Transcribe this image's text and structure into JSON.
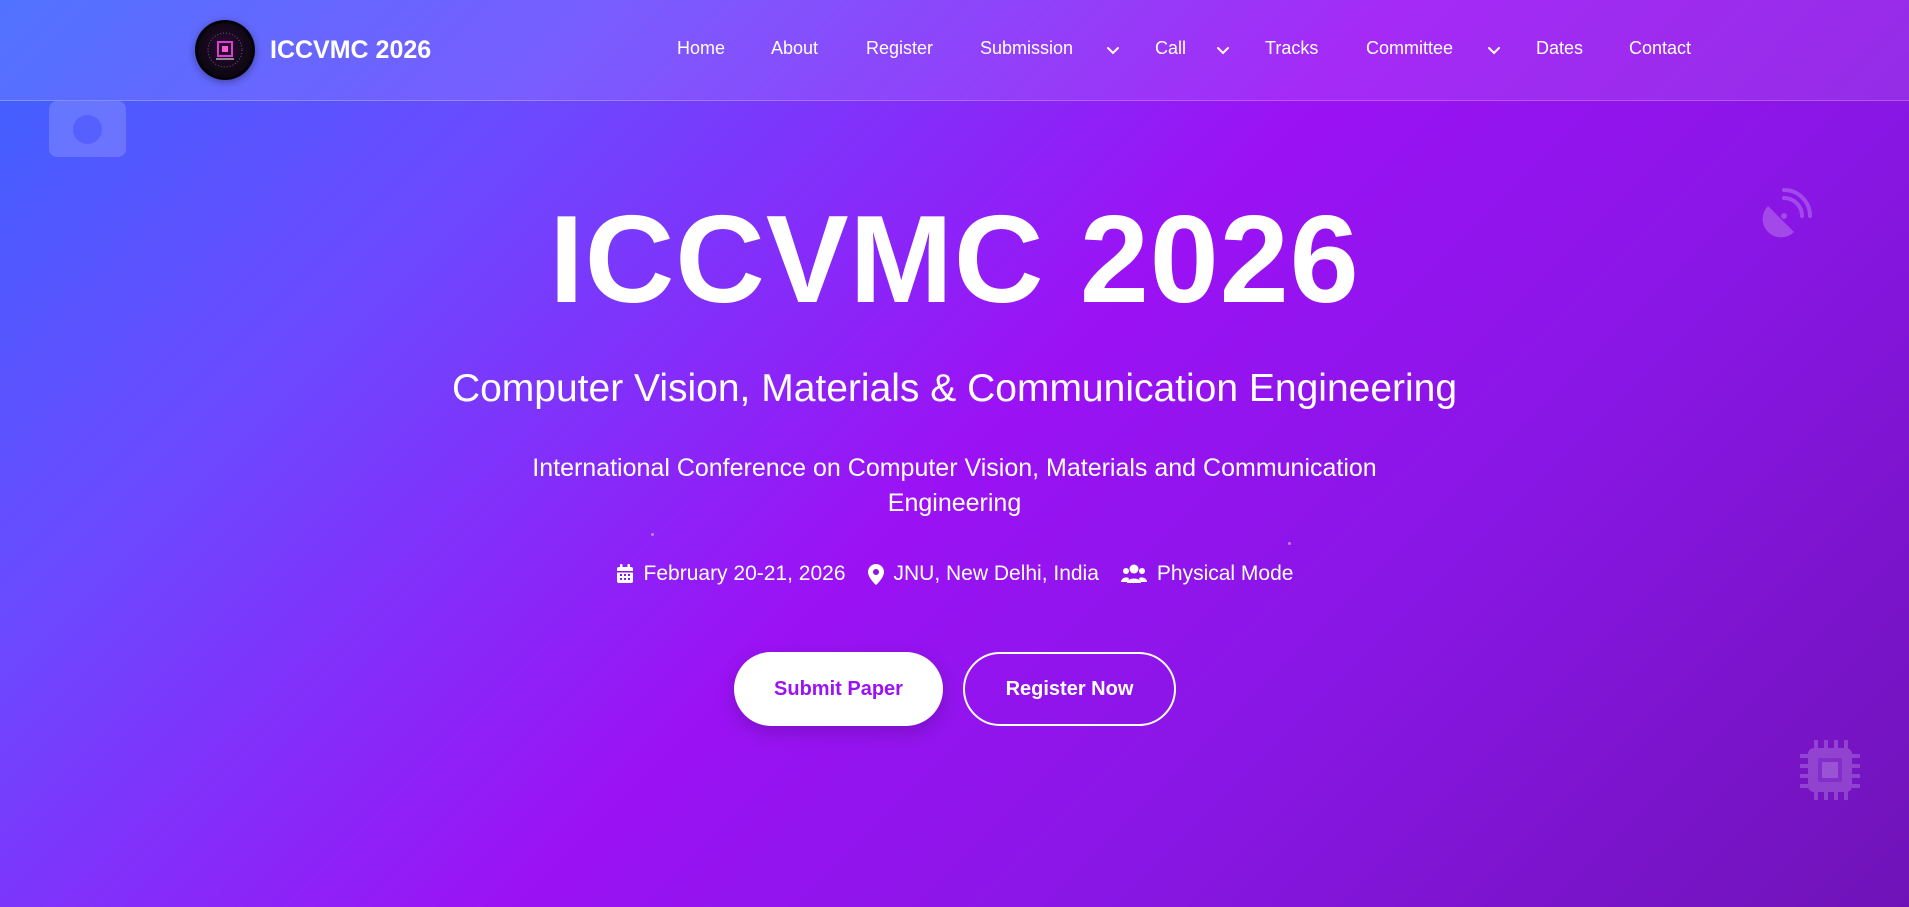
{
  "brand": {
    "title": "ICCVMC 2026",
    "logo_icon": "conference-logo-icon"
  },
  "nav": {
    "items": [
      {
        "label": "Home"
      },
      {
        "label": "About"
      },
      {
        "label": "Register"
      },
      {
        "label": "Submission",
        "has_dropdown": true
      },
      {
        "label": "Call",
        "has_dropdown": true
      },
      {
        "label": "Tracks"
      },
      {
        "label": "Committee",
        "has_dropdown": true
      },
      {
        "label": "Dates"
      },
      {
        "label": "Contact"
      }
    ]
  },
  "hero": {
    "title": "ICCVMC 2026",
    "subtitle": "Computer Vision, Materials & Communication Engineering",
    "description": "International Conference on Computer Vision, Materials and Communication Engineering",
    "meta": {
      "date": "February 20-21, 2026",
      "location": "JNU, New Delhi, India",
      "mode": "Physical Mode"
    },
    "buttons": {
      "submit": "Submit Paper",
      "register": "Register Now"
    }
  },
  "colors": {
    "gradient_start": "#3d63ff",
    "gradient_mid": "#9b12f5",
    "gradient_end": "#6f13b8",
    "primary_button_text": "#9b12f5"
  },
  "decorations": [
    "camera-icon",
    "satellite-dish-icon",
    "microchip-icon"
  ]
}
